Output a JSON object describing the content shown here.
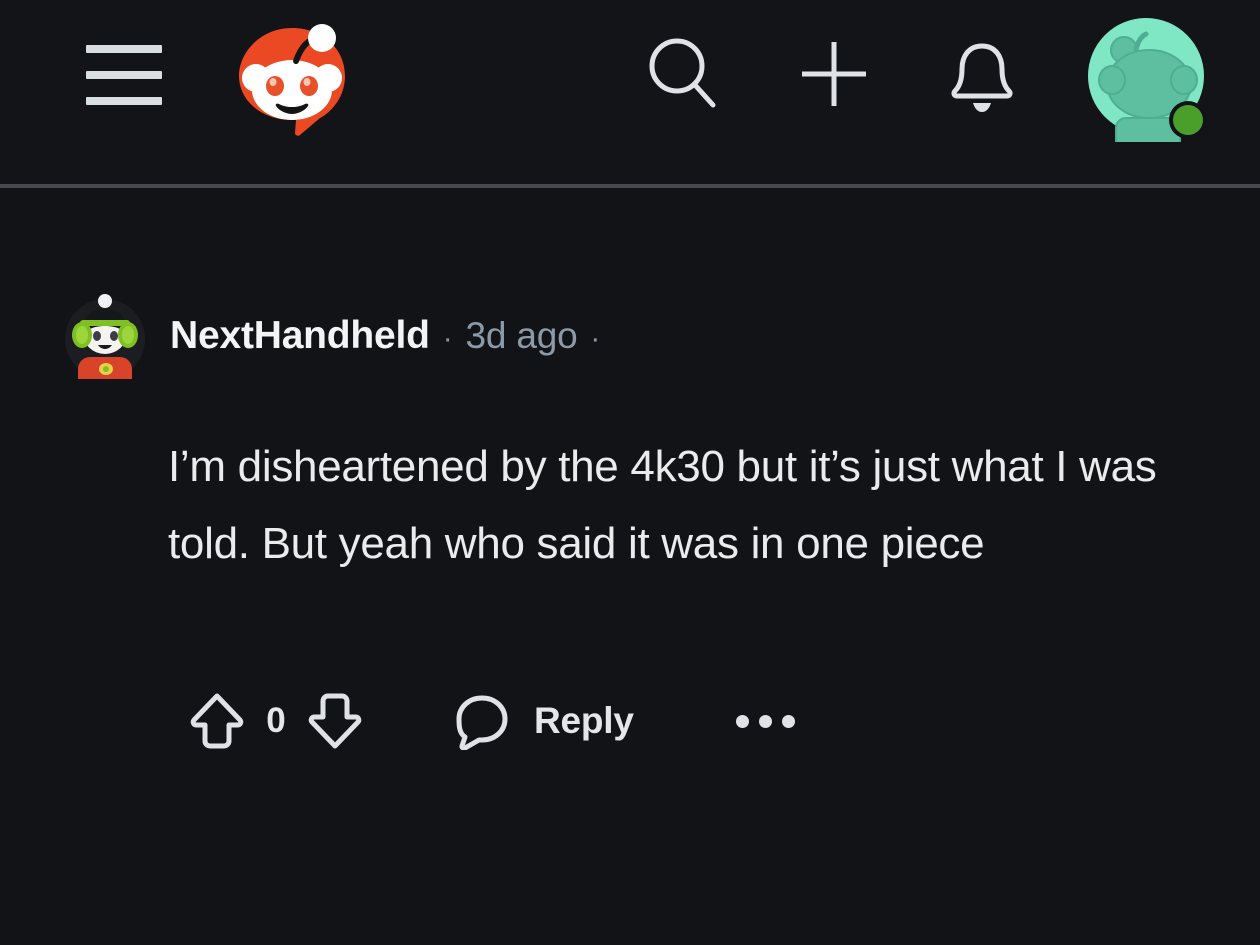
{
  "theme": {
    "background": "#121316",
    "topbar_background": "#131417",
    "divider": "#45494e",
    "text_primary": "#e9ebed",
    "text_secondary": "#8c9aa8",
    "icon_color": "#dfe3e7",
    "brand_orange": "#ea4923",
    "avatar_mint": "#7fe7c4",
    "online_green": "#4a9e2a"
  },
  "topbar": {
    "menu_button": "menu",
    "logo_label": "Reddit",
    "actions": [
      {
        "name": "search",
        "label": "Search",
        "icon": "search-icon"
      },
      {
        "name": "create",
        "label": "Create post",
        "icon": "plus-icon"
      },
      {
        "name": "notifications",
        "label": "Notifications",
        "icon": "bell-icon"
      }
    ],
    "account": {
      "label": "Account",
      "icon": "user-avatar",
      "online": true
    }
  },
  "comment": {
    "author": "NextHandheld",
    "separator": "·",
    "timestamp": "3d ago",
    "body": "I’m disheartened by the 4k30 but it’s just what I was told. But yeah who said it was in one piece",
    "avatar_alt": "NextHandheld avatar",
    "actions": {
      "upvote_label": "Upvote",
      "vote_count": "0",
      "downvote_label": "Downvote",
      "reply_label": "Reply",
      "overflow_label": "More options"
    }
  }
}
